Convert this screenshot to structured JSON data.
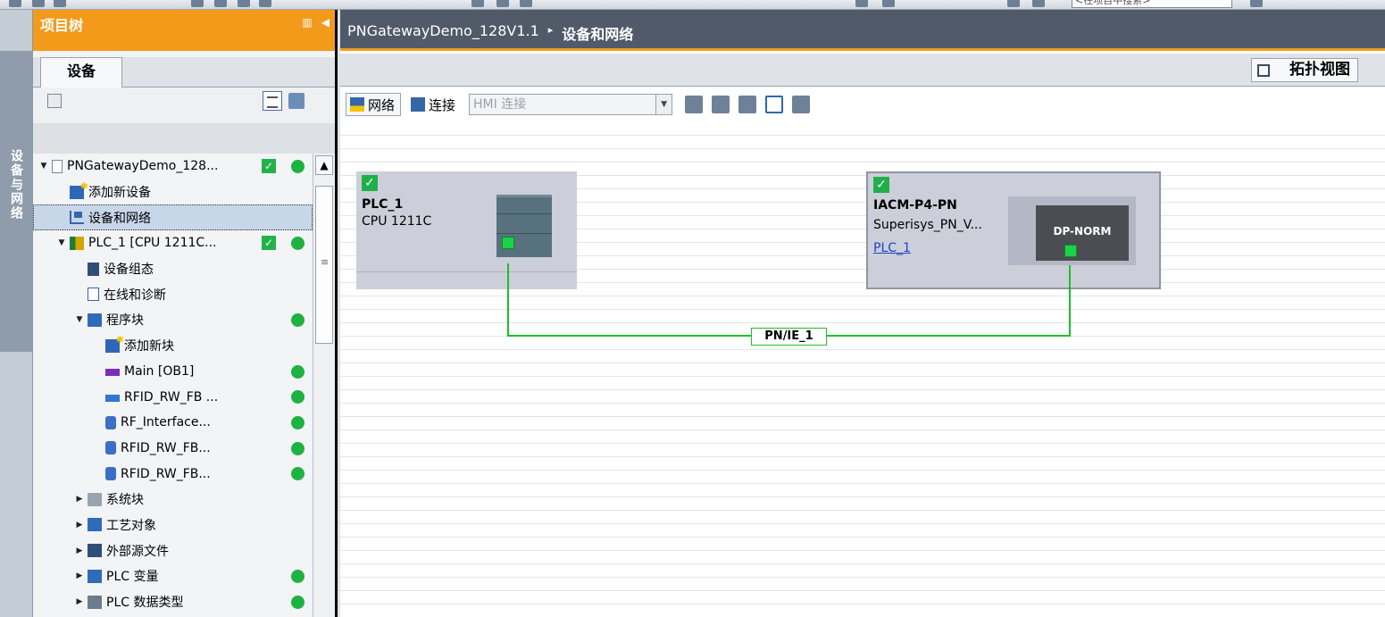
{
  "toolbar": {
    "search_placeholder": "<在项目中搜索>"
  },
  "side_strip": {
    "label": "设备与网络"
  },
  "tree": {
    "title": "项目树",
    "tab": "设备",
    "items": [
      {
        "label": "PNGatewayDemo_128...",
        "indent": 0,
        "arrow": "▼",
        "icon": "page",
        "check": true,
        "dot": true
      },
      {
        "label": "添加新设备",
        "indent": 1,
        "arrow": "",
        "icon": "star",
        "check": false,
        "dot": false
      },
      {
        "label": "设备和网络",
        "indent": 1,
        "arrow": "",
        "icon": "net",
        "check": false,
        "dot": false,
        "selected": true
      },
      {
        "label": "PLC_1 [CPU 1211C...",
        "indent": 1,
        "arrow": "▼",
        "icon": "plc",
        "check": true,
        "dot": true
      },
      {
        "label": "设备组态",
        "indent": 2,
        "arrow": "",
        "icon": "cfg",
        "check": false,
        "dot": false
      },
      {
        "label": "在线和诊断",
        "indent": 2,
        "arrow": "",
        "icon": "diag",
        "check": false,
        "dot": false
      },
      {
        "label": "程序块",
        "indent": 2,
        "arrow": "▼",
        "icon": "folder",
        "check": false,
        "dot": true
      },
      {
        "label": "添加新块",
        "indent": 3,
        "arrow": "",
        "icon": "star",
        "check": false,
        "dot": false
      },
      {
        "label": "Main [OB1]",
        "indent": 3,
        "arrow": "",
        "icon": "ob",
        "check": false,
        "dot": true
      },
      {
        "label": "RFID_RW_FB ...",
        "indent": 3,
        "arrow": "",
        "icon": "fb",
        "check": false,
        "dot": true
      },
      {
        "label": "RF_Interface...",
        "indent": 3,
        "arrow": "",
        "icon": "db",
        "check": false,
        "dot": true
      },
      {
        "label": "RFID_RW_FB...",
        "indent": 3,
        "arrow": "",
        "icon": "db",
        "check": false,
        "dot": true
      },
      {
        "label": "RFID_RW_FB...",
        "indent": 3,
        "arrow": "",
        "icon": "db",
        "check": false,
        "dot": true
      },
      {
        "label": "系统块",
        "indent": 2,
        "arrow": "▶",
        "icon": "folder-grey",
        "check": false,
        "dot": false
      },
      {
        "label": "工艺对象",
        "indent": 2,
        "arrow": "▶",
        "icon": "tech",
        "check": false,
        "dot": false
      },
      {
        "label": "外部源文件",
        "indent": 2,
        "arrow": "▶",
        "icon": "ext",
        "check": false,
        "dot": false
      },
      {
        "label": "PLC 变量",
        "indent": 2,
        "arrow": "▶",
        "icon": "var",
        "check": false,
        "dot": true
      },
      {
        "label": "PLC 数据类型",
        "indent": 2,
        "arrow": "▶",
        "icon": "dtype",
        "check": false,
        "dot": true
      }
    ]
  },
  "main": {
    "breadcrumb": [
      "PNGatewayDemo_128V1.1",
      "设备和网络"
    ],
    "breadcrumb_sep": "▸",
    "topology_tab": "拓扑视图",
    "net_toolbar": {
      "network_label": "网络",
      "connect_label": "连接",
      "hmi_select": "HMI 连接"
    },
    "devices": [
      {
        "name": "PLC_1",
        "type": "CPU 1211C"
      },
      {
        "name": "IACM-P4-PN",
        "type": "Superisys_PN_V...",
        "link": "PLC_1",
        "module_label": "DP-NORM"
      }
    ],
    "network_label": "PN/IE_1"
  },
  "colors": {
    "accent": "#f39a1b",
    "status_green": "#1db241",
    "network_green": "#1dbf2a",
    "link_blue": "#1b43c9"
  }
}
